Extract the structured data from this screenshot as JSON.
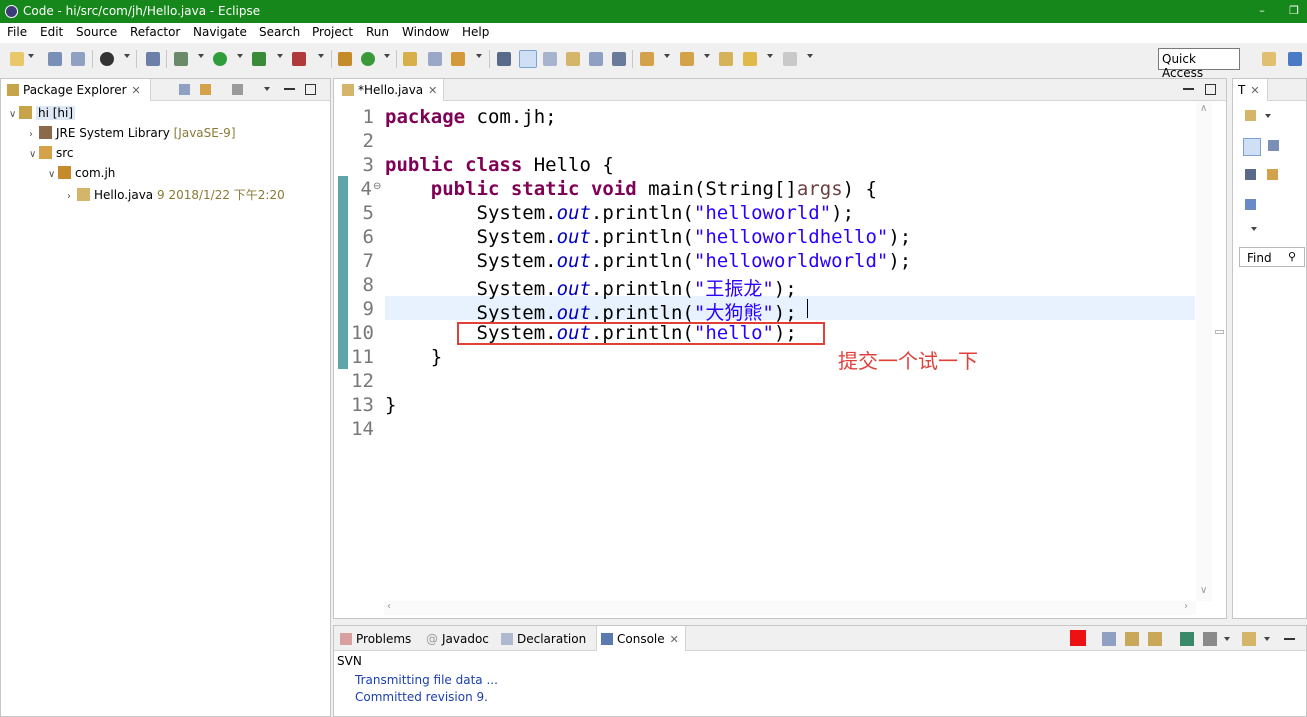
{
  "window": {
    "title": "Code - hi/src/com/jh/Hello.java - Eclipse",
    "minimize": "–",
    "restore": "❐"
  },
  "menu": [
    "File",
    "Edit",
    "Source",
    "Refactor",
    "Navigate",
    "Search",
    "Project",
    "Run",
    "Window",
    "Help"
  ],
  "toolbar": {
    "quick_access": "Quick Access"
  },
  "package_explorer": {
    "tab_label": "Package Explorer",
    "project": "hi [hi]",
    "jre_label": "JRE System Library",
    "jre_decor": "[JavaSE-9]",
    "src": "src",
    "package": "com.jh",
    "file": "Hello.java",
    "file_decor": "9  2018/1/22 下午2:20"
  },
  "editor": {
    "tab_label": "*Hello.java",
    "line_numbers": [
      "1",
      "2",
      "3",
      "4",
      "5",
      "6",
      "7",
      "8",
      "9",
      "10",
      "11",
      "12",
      "13",
      "14"
    ],
    "annotation": "提交一个试一下",
    "strings": {
      "s5": "\"helloworld\"",
      "s6": "\"helloworldhello\"",
      "s7": "\"helloworldworld\"",
      "s8": "\"王振龙\"",
      "s9": "\"大狗熊\"",
      "s10": "\"hello\""
    }
  },
  "outline": {
    "tab_label": "T",
    "find_placeholder": "Find"
  },
  "bottom_tabs": [
    "Problems",
    "Javadoc",
    "Declaration",
    "Console"
  ],
  "console": {
    "header": "SVN",
    "lines": [
      "Transmitting file data ...",
      "Committed revision 9."
    ]
  },
  "colors": {
    "titlebar": "#16881b",
    "keyword": "#7f0055",
    "string": "#2a00ff",
    "annotation_red": "#e0403a",
    "change_bar": "#5fa4a8"
  }
}
